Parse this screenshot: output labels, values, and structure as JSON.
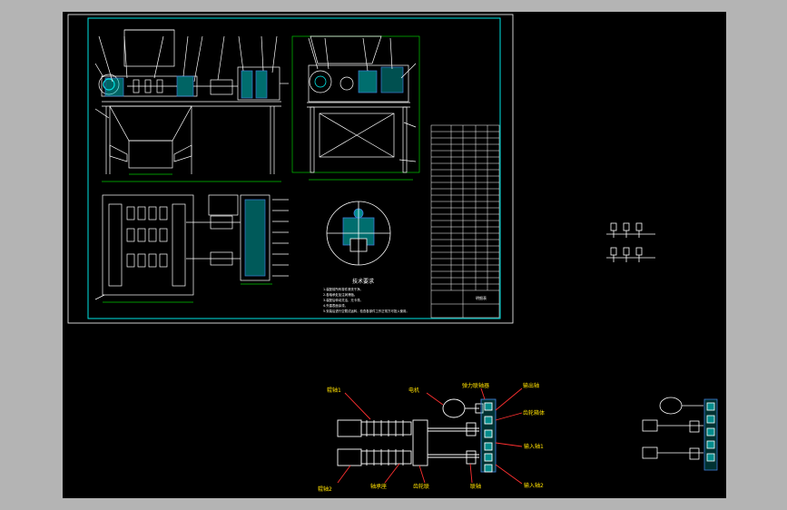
{
  "colors": {
    "outer_bg": "#b4b4b4",
    "workspace_bg": "#000000",
    "line": "#ffffff",
    "frame_cyan": "#00e5e5",
    "accent_cyan": "#00ffff",
    "highlight_blue": "#3f7fd6",
    "label_yellow": "#ffe000",
    "dim_green": "#00c800",
    "leader_red": "#ff3030"
  },
  "tech_requirements": {
    "title": "技术要求",
    "items": [
      "1.装配前所有零件清洗干净。",
      "2.各轴承处加注润滑脂。",
      "3.装配后转动灵活，无卡滞。",
      "4.外露表面涂漆。",
      "5.安装后进行空载试运转，检查各部件工作正常方可投入使用。"
    ]
  },
  "bom": {
    "note": "明细表"
  },
  "schematic": {
    "labels": {
      "roller1": "辊轴1",
      "motor": "电机",
      "coupling": "弹力联轴器",
      "output_shaft": "输出轴",
      "gear_box": "齿轮箱体",
      "input_shaft1": "输入轴1",
      "input_shaft2": "输入轴2",
      "roller2": "辊轴2",
      "bearing_seat": "轴承座",
      "gear_coupling": "齿轮联",
      "shaft_coupling": "联轴"
    }
  }
}
